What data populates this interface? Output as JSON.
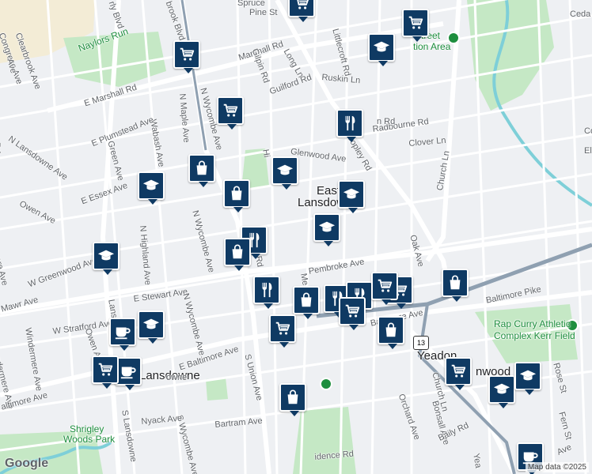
{
  "map": {
    "area_labels": [
      {
        "key": "east_lansdowne_1",
        "text": "East",
        "cls": "big"
      },
      {
        "key": "east_lansdowne_2",
        "text": "Lansdowne",
        "cls": "big"
      },
      {
        "key": "lansdowne",
        "text": "Lansdowne",
        "cls": "big"
      },
      {
        "key": "yeadon",
        "text": "Yeadon",
        "cls": "big"
      },
      {
        "key": "nwood",
        "text": "nwood",
        "cls": "big"
      },
      {
        "key": "rap_curry_1",
        "text": "Rap Curry Athletic",
        "cls": "green"
      },
      {
        "key": "rap_curry_2",
        "text": "Complex Kerr Field",
        "cls": "green"
      },
      {
        "key": "shrigley_1",
        "text": "Shrigley",
        "cls": "green"
      },
      {
        "key": "shrigley_2",
        "text": "Woods Park",
        "cls": "green"
      },
      {
        "key": "street_rec",
        "text": "treet",
        "cls": "green"
      },
      {
        "key": "tion_area",
        "text": "tion Area",
        "cls": "green"
      },
      {
        "key": "naylors_run",
        "text": "Naylors Run",
        "cls": "green"
      }
    ],
    "street_labels": [
      {
        "key": "pine",
        "text": "Pine St"
      },
      {
        "key": "spruce",
        "text": "Spruce"
      },
      {
        "key": "marshall_rd_n",
        "text": "Marshall Rd"
      },
      {
        "key": "e_marshall",
        "text": "E Marshall Rd"
      },
      {
        "key": "long_ln",
        "text": "Long Ln"
      },
      {
        "key": "gilpin",
        "text": "Gilpin Rd"
      },
      {
        "key": "littlecroft",
        "text": "Littlecroft Rd"
      },
      {
        "key": "ruskin",
        "text": "Ruskin Ln"
      },
      {
        "key": "guilford",
        "text": "Guilford Rd"
      },
      {
        "key": "radbourne",
        "text": "Radbourne Rd"
      },
      {
        "key": "n_rd",
        "text": "n Rd"
      },
      {
        "key": "clover",
        "text": "Clover Ln"
      },
      {
        "key": "copley",
        "text": "Copley Rd"
      },
      {
        "key": "glenwood",
        "text": "Glenwood Ave"
      },
      {
        "key": "church_ln",
        "text": "Church Ln"
      },
      {
        "key": "oak_ave",
        "text": "Oak Ave"
      },
      {
        "key": "pembroke",
        "text": "Pembroke Ave"
      },
      {
        "key": "baltimore_pike",
        "text": "Baltimore Pike"
      },
      {
        "key": "e_baltimore",
        "text": "E Baltimore Ave"
      },
      {
        "key": "baltimore_ave",
        "text": "Baltimore Ave"
      },
      {
        "key": "e_stewart",
        "text": "E Stewart Ave"
      },
      {
        "key": "w_stratford",
        "text": "W Stratford Ave"
      },
      {
        "key": "w_greenwood",
        "text": "W Greenwood Ave"
      },
      {
        "key": "owen_ave",
        "text": "Owen Ave"
      },
      {
        "key": "owen_ave2",
        "text": "Owen Ave"
      },
      {
        "key": "e_essex",
        "text": "E Essex Ave"
      },
      {
        "key": "n_lansdowne",
        "text": "N Lansdowne Ave"
      },
      {
        "key": "n_highland",
        "text": "N Highland Ave"
      },
      {
        "key": "n_wycombe",
        "text": "N Wycombe Ave"
      },
      {
        "key": "n_wycombe2",
        "text": "N Wycombe Ave"
      },
      {
        "key": "n_wycombe3",
        "text": "N Wycombe Ave"
      },
      {
        "key": "n_maple",
        "text": "N Maple Ave"
      },
      {
        "key": "wabash",
        "text": "Wabash Ave"
      },
      {
        "key": "green_ave",
        "text": "Green Ave"
      },
      {
        "key": "e_plumstead",
        "text": "E Plumstead Ave"
      },
      {
        "key": "clearbrook",
        "text": "Clearbrook Ave"
      },
      {
        "key": "congress",
        "text": "Congress Ave"
      },
      {
        "key": "brook_blvd",
        "text": "brook Blvd"
      },
      {
        "key": "rly_blvd",
        "text": "rly Blvd"
      },
      {
        "key": "s_union",
        "text": "S Union Ave"
      },
      {
        "key": "s_lansdowne",
        "text": "S Lansdowne"
      },
      {
        "key": "s_wycombe",
        "text": "S Wycombe Ave"
      },
      {
        "key": "nyack",
        "text": "Nyack Ave"
      },
      {
        "key": "bartram",
        "text": "Bartram Ave"
      },
      {
        "key": "windermere",
        "text": "Windermere Ave"
      },
      {
        "key": "windermere2",
        "text": "ndermere Ave"
      },
      {
        "key": "mawr",
        "text": "Mawr Ave"
      },
      {
        "key": "bonsall",
        "text": "Bonsall Ave"
      },
      {
        "key": "orchard",
        "text": "Orchard Ave"
      },
      {
        "key": "baily",
        "text": "Baily Rd"
      },
      {
        "key": "rose",
        "text": "Rose St"
      },
      {
        "key": "fern",
        "text": "Fern St"
      },
      {
        "key": "church_ln2",
        "text": "Church Ln"
      },
      {
        "key": "idence",
        "text": "idence Rd"
      },
      {
        "key": "cedar",
        "text": "Ceda"
      },
      {
        "key": "more_ave",
        "text": "more Ave"
      },
      {
        "key": "rd_left",
        "text": "Rd"
      },
      {
        "key": "ave_sw",
        "text": "Ave"
      },
      {
        "key": "ave_se",
        "text": "Ave"
      },
      {
        "key": "altimore",
        "text": "altimore Ave"
      },
      {
        "key": "rd_short",
        "text": "Rd"
      },
      {
        "key": "me_short",
        "text": "Me"
      },
      {
        "key": "hi_short",
        "text": "Hi"
      },
      {
        "key": "owne",
        "text": "owne"
      },
      {
        "key": "lans_v",
        "text": "Lans"
      },
      {
        "key": "yea_s",
        "text": "Yea"
      },
      {
        "key": "el_e",
        "text": "El"
      },
      {
        "key": "co",
        "text": "Co"
      }
    ],
    "route_shield": "13",
    "google_logo": "Google",
    "attribution": "Map data ©2025",
    "pins": [
      {
        "key": "p1",
        "icon": "cart"
      },
      {
        "key": "p2",
        "icon": "cart"
      },
      {
        "key": "p3",
        "icon": "school"
      },
      {
        "key": "p4",
        "icon": "cart"
      },
      {
        "key": "p5",
        "icon": "cart"
      },
      {
        "key": "p6",
        "icon": "restaurant"
      },
      {
        "key": "p7",
        "icon": "school"
      },
      {
        "key": "p8",
        "icon": "bag"
      },
      {
        "key": "p9",
        "icon": "school"
      },
      {
        "key": "p10",
        "icon": "bag"
      },
      {
        "key": "p11",
        "icon": "school"
      },
      {
        "key": "p12",
        "icon": "school"
      },
      {
        "key": "p13",
        "icon": "restaurant"
      },
      {
        "key": "p14",
        "icon": "bag"
      },
      {
        "key": "p15",
        "icon": "school"
      },
      {
        "key": "p16",
        "icon": "restaurant"
      },
      {
        "key": "p17",
        "icon": "bag"
      },
      {
        "key": "p18",
        "icon": "restaurant"
      },
      {
        "key": "p19",
        "icon": "restaurant"
      },
      {
        "key": "p20",
        "icon": "cart"
      },
      {
        "key": "p21",
        "icon": "cart"
      },
      {
        "key": "p22",
        "icon": "cart"
      },
      {
        "key": "p23",
        "icon": "bag"
      },
      {
        "key": "p24",
        "icon": "bag"
      },
      {
        "key": "p25",
        "icon": "cup"
      },
      {
        "key": "p26",
        "icon": "school"
      },
      {
        "key": "p27",
        "icon": "cup"
      },
      {
        "key": "p28",
        "icon": "cart"
      },
      {
        "key": "p29",
        "icon": "cart"
      },
      {
        "key": "p30",
        "icon": "bag"
      },
      {
        "key": "p31",
        "icon": "cart"
      },
      {
        "key": "p32",
        "icon": "school"
      },
      {
        "key": "p33",
        "icon": "school"
      },
      {
        "key": "p34",
        "icon": "cup"
      }
    ],
    "colors": {
      "background": "#eef0f3",
      "pin": "#0f3a63",
      "park": "#c5e8c5",
      "water": "#7ecfd8",
      "major_road": "#ffffff",
      "highway": "#8fa0b1"
    }
  }
}
